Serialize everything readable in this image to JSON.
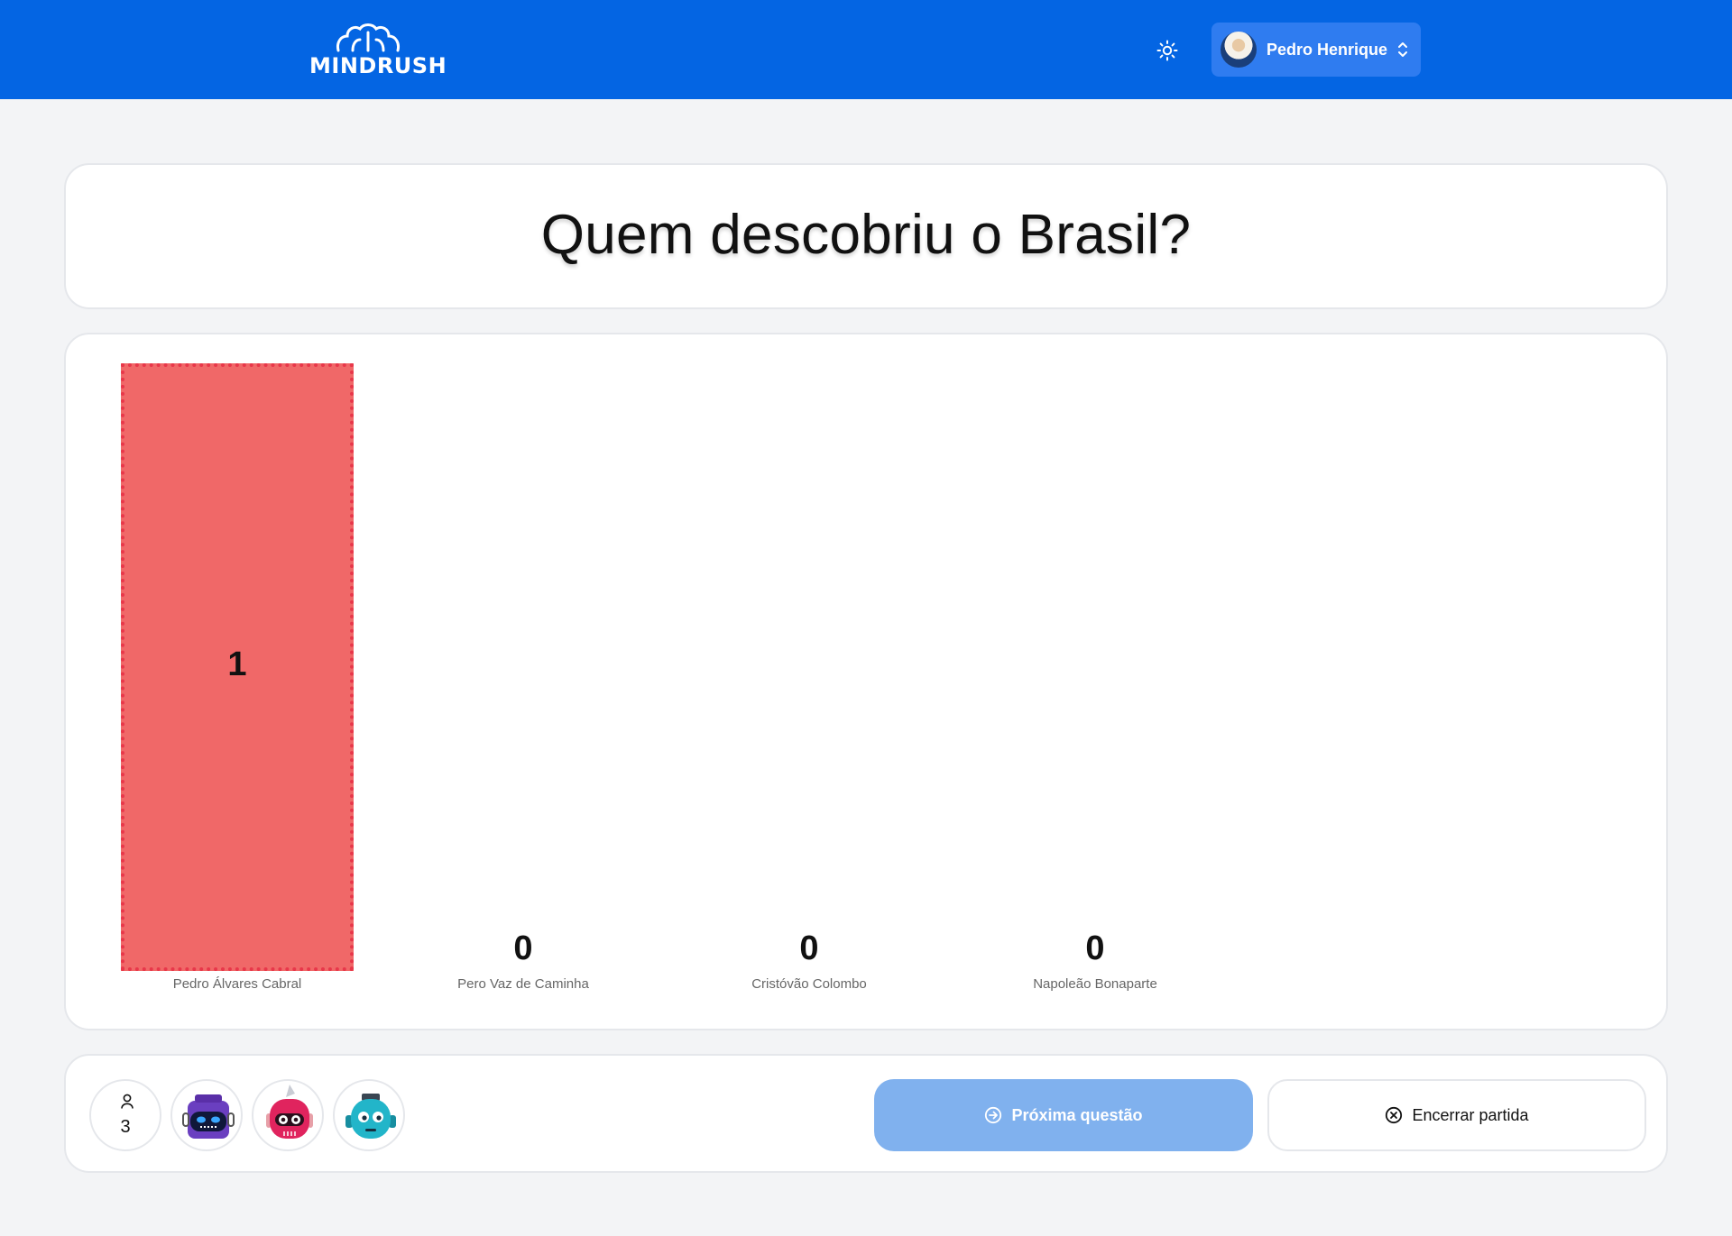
{
  "header": {
    "logo_text": "MINDRUSH",
    "user_name": "Pedro Henrique"
  },
  "question": {
    "text": "Quem descobriu o Brasil?"
  },
  "chart_data": {
    "type": "bar",
    "categories": [
      "Pedro Álvares Cabral",
      "Pero Vaz de Caminha",
      "Cristóvão Colombo",
      "Napoleão Bonaparte"
    ],
    "values": [
      1,
      0,
      0,
      0
    ],
    "ylim": [
      0,
      1
    ],
    "bar_color": "#f06868",
    "bar_border_color": "#e8374a"
  },
  "players": {
    "count": "3",
    "avatars": [
      "robot-purple",
      "robot-pink",
      "robot-teal"
    ]
  },
  "actions": {
    "next_label": "Próxima questão",
    "end_label": "Encerrar partida"
  },
  "colors": {
    "header_bg": "#0465e3",
    "next_button_bg": "#80b1ee"
  }
}
